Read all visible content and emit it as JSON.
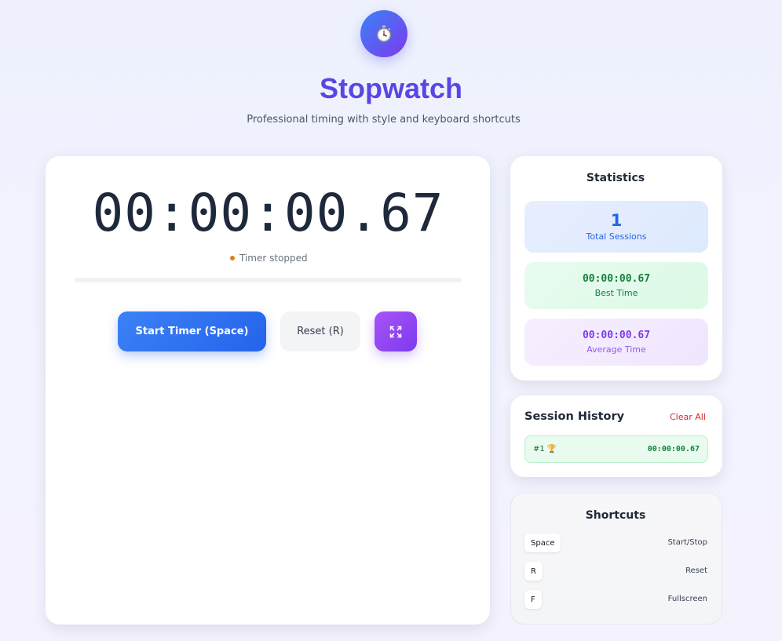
{
  "header": {
    "logo_icon": "stopwatch-icon",
    "title": "Stopwatch",
    "subtitle": "Professional timing with style and keyboard shortcuts"
  },
  "timer": {
    "display": "00:00:00.67",
    "status": "Timer stopped",
    "status_color": "#e57c1f",
    "progress_fraction": 0
  },
  "controls": {
    "start_label": "Start Timer (Space)",
    "reset_label": "Reset (R)",
    "fullscreen_icon": "fullscreen-icon"
  },
  "statistics": {
    "title": "Statistics",
    "total_sessions_value": "1",
    "total_sessions_label": "Total Sessions",
    "best_time_value": "00:00:00.67",
    "best_time_label": "Best Time",
    "average_time_value": "00:00:00.67",
    "average_time_label": "Average Time"
  },
  "history": {
    "title": "Session History",
    "clear_label": "Clear All",
    "sessions": [
      {
        "label": "#1 🏆",
        "time": "00:00:00.67"
      }
    ]
  },
  "shortcuts": {
    "title": "Shortcuts",
    "items": [
      {
        "key": "Space",
        "action": "Start/Stop"
      },
      {
        "key": "R",
        "action": "Reset"
      },
      {
        "key": "F",
        "action": "Fullscreen"
      }
    ]
  },
  "colors": {
    "accent": "#5b45e4",
    "primary": "#2563eb",
    "success": "#15803d",
    "purple": "#7c3aed",
    "danger": "#dc2626"
  }
}
